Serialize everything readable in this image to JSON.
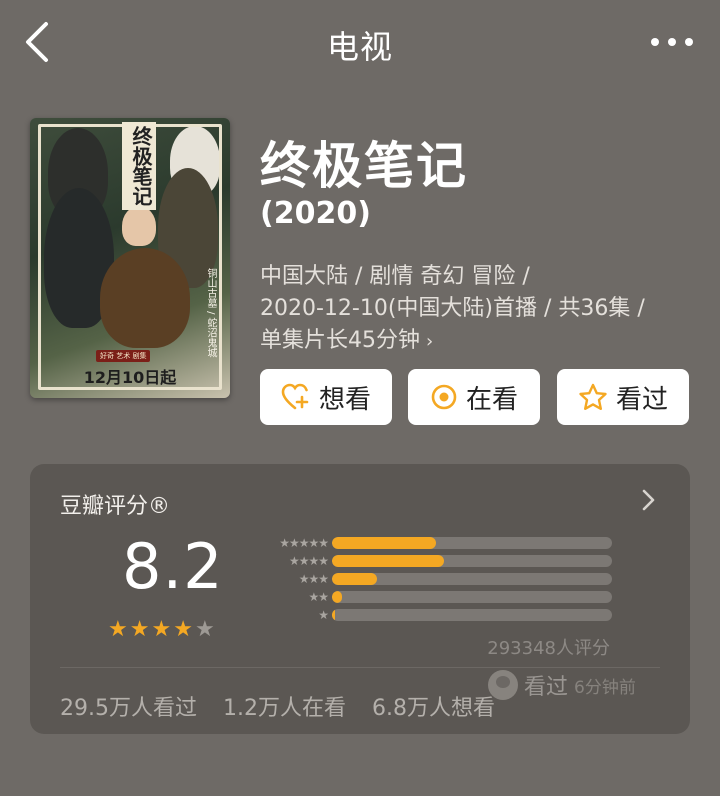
{
  "header": {
    "title": "电视",
    "back_icon": "chevron-left-icon",
    "more_icon": "more-dots-icon"
  },
  "poster": {
    "title_art": "终极笔记",
    "side_text": "铜山古墓 / 蛇沼鬼城",
    "badge": "好奇 艺术 剧集",
    "date_text": "12月10日起"
  },
  "movie": {
    "title": "终极笔记",
    "year": "(2020)",
    "meta_line1": "中国大陆 / 剧情 奇幻 冒险 /",
    "meta_line2": "2020-12-10(中国大陆)首播 / 共36集 /",
    "meta_line3": "单集片长45分钟",
    "meta_more": "›"
  },
  "actions": {
    "want": "想看",
    "watching": "在看",
    "watched": "看过"
  },
  "rating": {
    "label": "豆瓣评分®",
    "score": "8.2",
    "stars_filled": 4,
    "stars_total": 5,
    "distribution": [
      {
        "stars": "★★★★★",
        "fraction": 0.37
      },
      {
        "stars": "★★★★",
        "fraction": 0.4
      },
      {
        "stars": "★★★",
        "fraction": 0.16
      },
      {
        "stars": "★★",
        "fraction": 0.035
      },
      {
        "stars": "★",
        "fraction": 0.01
      }
    ],
    "count": "293348人评分",
    "stats": {
      "watched": "29.5万人看过",
      "watching": "1.2万人在看",
      "want": "6.8万人想看"
    }
  },
  "watermark": {
    "action": "看过",
    "time": "6分钟前"
  },
  "colors": {
    "background": "#6e6a66",
    "card": "#5b5753",
    "accent": "#f4a823"
  }
}
